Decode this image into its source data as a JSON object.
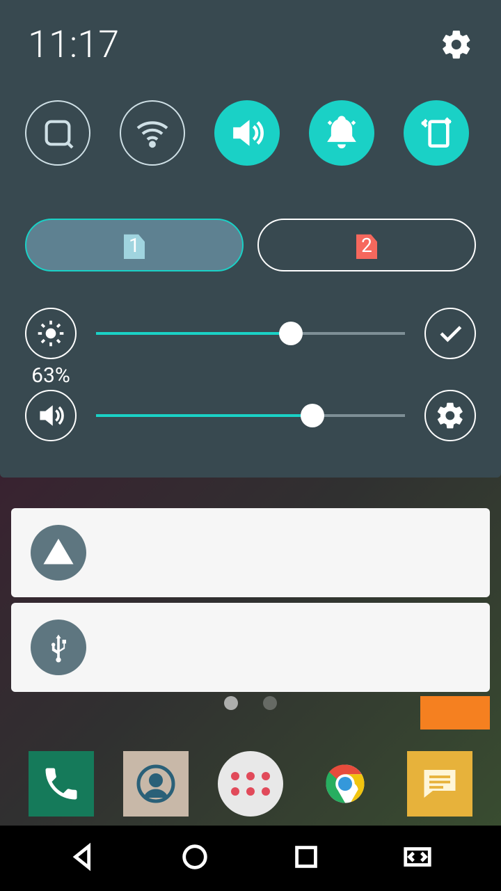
{
  "status": {
    "time": "11:17"
  },
  "toggles": {
    "screenshot": {
      "active": false
    },
    "wifi": {
      "active": false
    },
    "sound": {
      "active": true
    },
    "notifications": {
      "active": true
    },
    "rotation": {
      "active": true
    }
  },
  "sims": {
    "sim1": {
      "label": "1",
      "active": true
    },
    "sim2": {
      "label": "2",
      "active": false
    }
  },
  "brightness": {
    "percent_label": "63%",
    "percent": 63
  },
  "volume": {
    "percent": 70
  },
  "notifications_list": [
    {
      "icon": "warning"
    },
    {
      "icon": "usb"
    }
  ],
  "colors": {
    "accent": "#1ad1c6",
    "panel": "#384950",
    "warning_red": "#f6685d"
  }
}
